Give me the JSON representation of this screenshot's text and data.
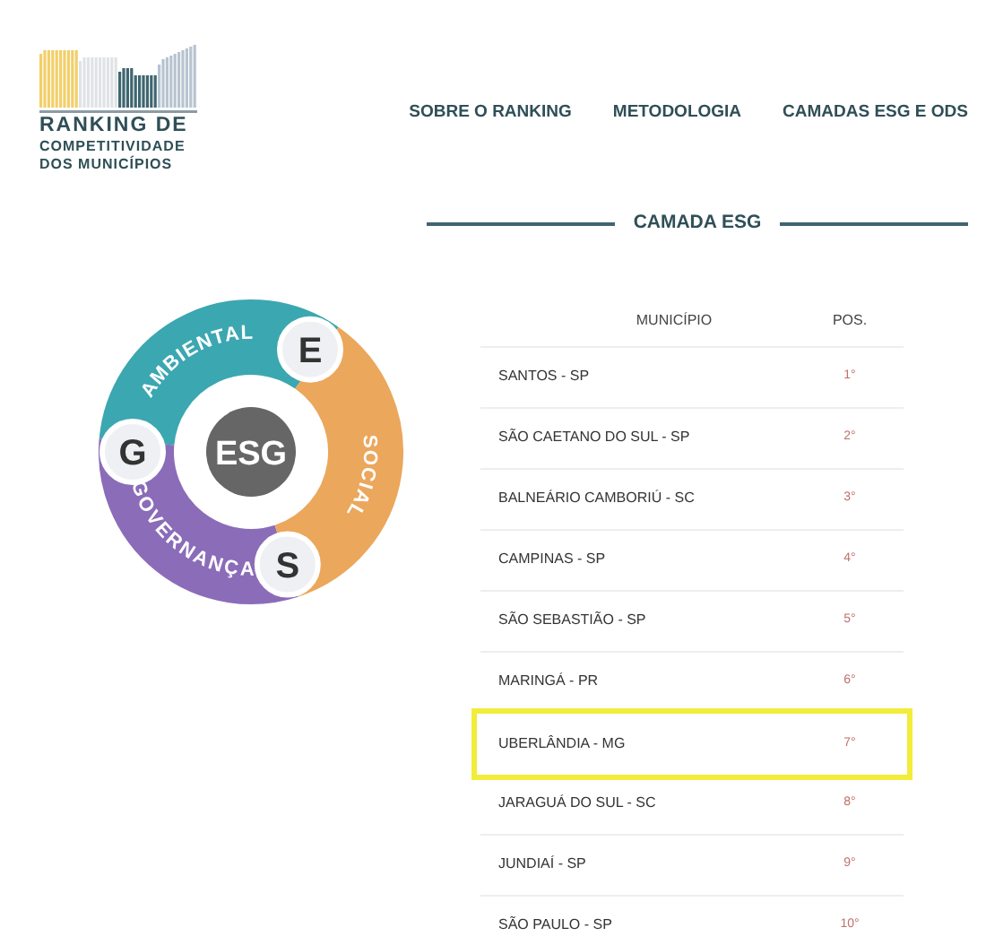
{
  "logo": {
    "line_1": "RANKING DE",
    "line_2": "COMPETITIVIDADE",
    "line_3": "DOS MUNICÍPIOS"
  },
  "nav": [
    "SOBRE O RANKING",
    "METODOLOGIA",
    "CAMADAS ESG E ODS"
  ],
  "section_title": "CAMADA ESG",
  "esg_diagram": {
    "center": "ESG",
    "segments": [
      {
        "kind": "environmental",
        "letter": "E",
        "label": "AMBIENTAL",
        "color": "#3ba7b1"
      },
      {
        "kind": "governance",
        "letter": "G",
        "label": "GOVERNANÇA",
        "color": "#8b6cb8"
      },
      {
        "kind": "social",
        "letter": "S",
        "label": "SOCIAL",
        "color": "#eba75c"
      }
    ]
  },
  "table": {
    "columns": [
      "MUNICÍPIO",
      "POS."
    ],
    "rows": [
      {
        "municipality": "SANTOS - SP",
        "position": "1°",
        "highlighted": false
      },
      {
        "municipality": "SÃO CAETANO DO SUL - SP",
        "position": "2°",
        "highlighted": false
      },
      {
        "municipality": "BALNEÁRIO CAMBORIÚ - SC",
        "position": "3°",
        "highlighted": false
      },
      {
        "municipality": "CAMPINAS - SP",
        "position": "4°",
        "highlighted": false
      },
      {
        "municipality": "SÃO SEBASTIÃO - SP",
        "position": "5°",
        "highlighted": false
      },
      {
        "municipality": "MARINGÁ - PR",
        "position": "6°",
        "highlighted": false
      },
      {
        "municipality": "UBERLÂNDIA - MG",
        "position": "7°",
        "highlighted": true
      },
      {
        "municipality": "JARAGUÁ DO SUL - SC",
        "position": "8°",
        "highlighted": false
      },
      {
        "municipality": "JUNDIAÍ - SP",
        "position": "9°",
        "highlighted": false
      },
      {
        "municipality": "SÃO PAULO - SP",
        "position": "10°",
        "highlighted": false
      }
    ]
  }
}
